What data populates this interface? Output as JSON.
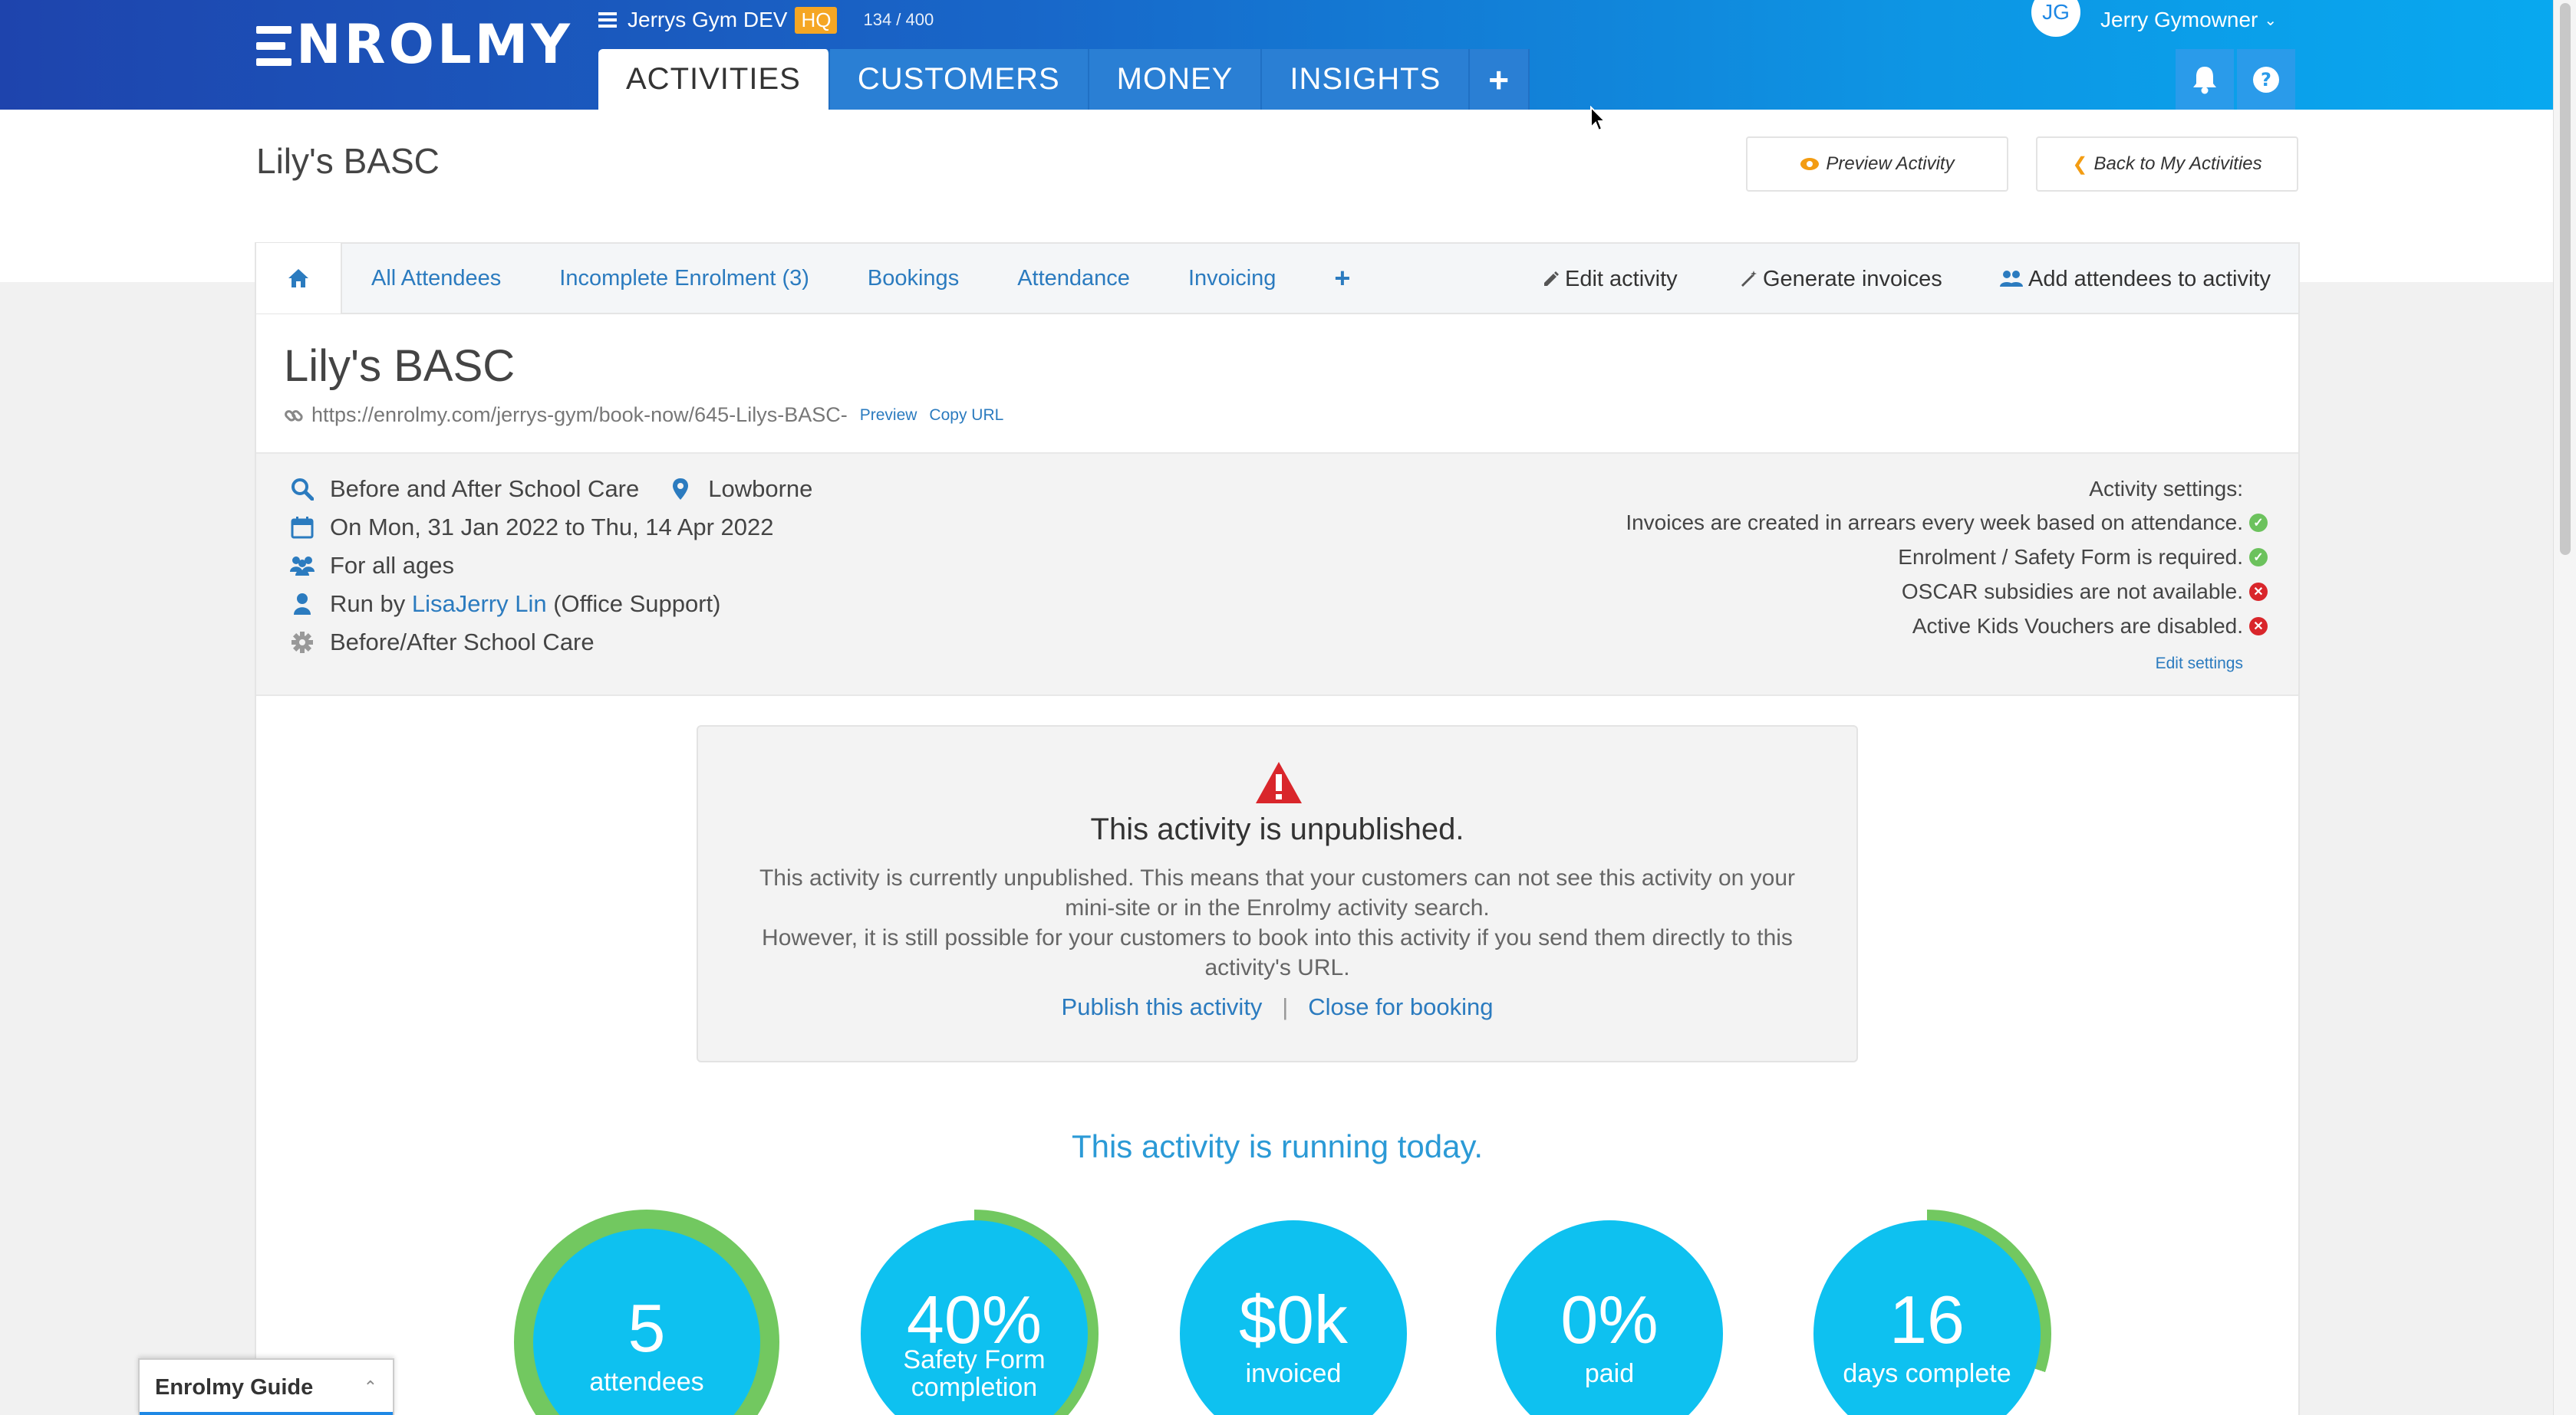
{
  "app": {
    "logo_text": "NROLMY",
    "org_name": "Jerrys Gym DEV",
    "org_badge": "HQ",
    "usage_count": "134 / 400",
    "user_initials": "JG",
    "user_name": "Jerry Gymowner"
  },
  "nav": {
    "tabs": [
      "ACTIVITIES",
      "CUSTOMERS",
      "MONEY",
      "INSIGHTS"
    ],
    "active_tab": "ACTIVITIES",
    "plus_label": "+"
  },
  "page": {
    "title": "Lily's BASC",
    "preview_button": "Preview Activity",
    "back_button": "Back to My Activities"
  },
  "subnav": {
    "tabs": [
      "All Attendees",
      "Incomplete Enrolment (3)",
      "Bookings",
      "Attendance",
      "Invoicing"
    ],
    "plus_label": "+",
    "actions": [
      "Edit activity",
      "Generate invoices",
      "Add attendees to activity"
    ]
  },
  "activity": {
    "title": "Lily's BASC",
    "url": "https://enrolmy.com/jerrys-gym/book-now/645-Lilys-BASC-",
    "preview_link": "Preview",
    "copy_url_link": "Copy URL",
    "category": "Before and After School Care",
    "location": "Lowborne",
    "dates": "On Mon, 31 Jan 2022 to Thu, 14 Apr 2022",
    "ages": "For all ages",
    "run_by_prefix": "Run by",
    "run_by_name": "LisaJerry Lin",
    "run_by_suffix": "(Office Support)",
    "type": "Before/After School Care"
  },
  "settings": {
    "heading": "Activity settings:",
    "items": [
      {
        "text": "Invoices are created in arrears every week based on attendance.",
        "status": "ok"
      },
      {
        "text": "Enrolment / Safety Form is required.",
        "status": "ok"
      },
      {
        "text": "OSCAR subsidies are not available.",
        "status": "bad"
      },
      {
        "text": "Active Kids Vouchers are disabled.",
        "status": "bad"
      }
    ],
    "edit_link": "Edit settings"
  },
  "warning": {
    "title": "This activity is unpublished.",
    "text_line1": "This activity is currently unpublished. This means that your customers can not see this activity on your mini-site or in the Enrolmy activity search.",
    "text_line2": "However, it is still possible for your customers to book into this activity if you send them directly to this activity's URL.",
    "publish_link": "Publish this activity",
    "separator": "|",
    "close_link": "Close for booking"
  },
  "running_text": "This activity is running today.",
  "stats": [
    {
      "value": "5",
      "label": "attendees",
      "progress": 1.0
    },
    {
      "value": "40%",
      "label": "Safety Form completion",
      "progress": 0.4
    },
    {
      "value": "$0k",
      "label": "invoiced",
      "progress": 0.0
    },
    {
      "value": "0%",
      "label": "paid",
      "progress": 0.0
    },
    {
      "value": "16",
      "label": "days complete",
      "progress": 0.3
    }
  ],
  "colors": {
    "accent": "#2b7bbf",
    "stat_fill": "#0ec1f0",
    "progress_ring": "#72c860",
    "ok": "#6cc25d",
    "bad": "#d9262b",
    "badge": "#f5a623"
  },
  "guide": {
    "label": "Enrolmy Guide"
  }
}
